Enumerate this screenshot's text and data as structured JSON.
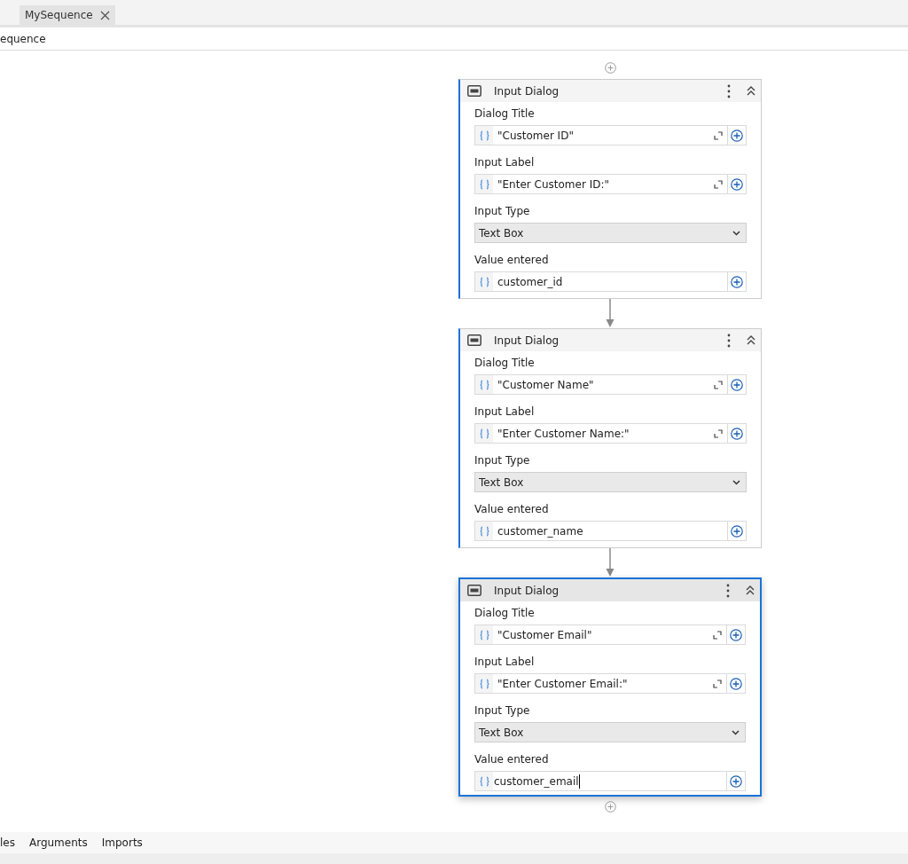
{
  "tabs": [
    {
      "label": "MySequence",
      "selected": true
    }
  ],
  "breadcrumb": "equence",
  "activities": [
    {
      "title": "Input Dialog",
      "selected": false,
      "fields": [
        {
          "label": "Dialog Title",
          "kind": "expression",
          "value": "\"Customer ID\""
        },
        {
          "label": "Input Label",
          "kind": "expression",
          "value": "\"Enter Customer ID:\""
        },
        {
          "label": "Input Type",
          "kind": "dropdown",
          "value": "Text Box"
        },
        {
          "label": "Value entered",
          "kind": "variable",
          "value": "customer_id",
          "focused": false
        }
      ]
    },
    {
      "title": "Input Dialog",
      "selected": false,
      "fields": [
        {
          "label": "Dialog Title",
          "kind": "expression",
          "value": "\"Customer Name\""
        },
        {
          "label": "Input Label",
          "kind": "expression",
          "value": "\"Enter Customer Name:\""
        },
        {
          "label": "Input Type",
          "kind": "dropdown",
          "value": "Text Box"
        },
        {
          "label": "Value entered",
          "kind": "variable",
          "value": "customer_name",
          "focused": false
        }
      ]
    },
    {
      "title": "Input Dialog",
      "selected": true,
      "fields": [
        {
          "label": "Dialog Title",
          "kind": "expression",
          "value": "\"Customer Email\""
        },
        {
          "label": "Input Label",
          "kind": "expression",
          "value": "\"Enter Customer Email:\""
        },
        {
          "label": "Input Type",
          "kind": "dropdown",
          "value": "Text Box"
        },
        {
          "label": "Value entered",
          "kind": "variable",
          "value": "customer_email",
          "focused": true
        }
      ]
    }
  ],
  "bottom_tabs": [
    "les",
    "Arguments",
    "Imports"
  ]
}
